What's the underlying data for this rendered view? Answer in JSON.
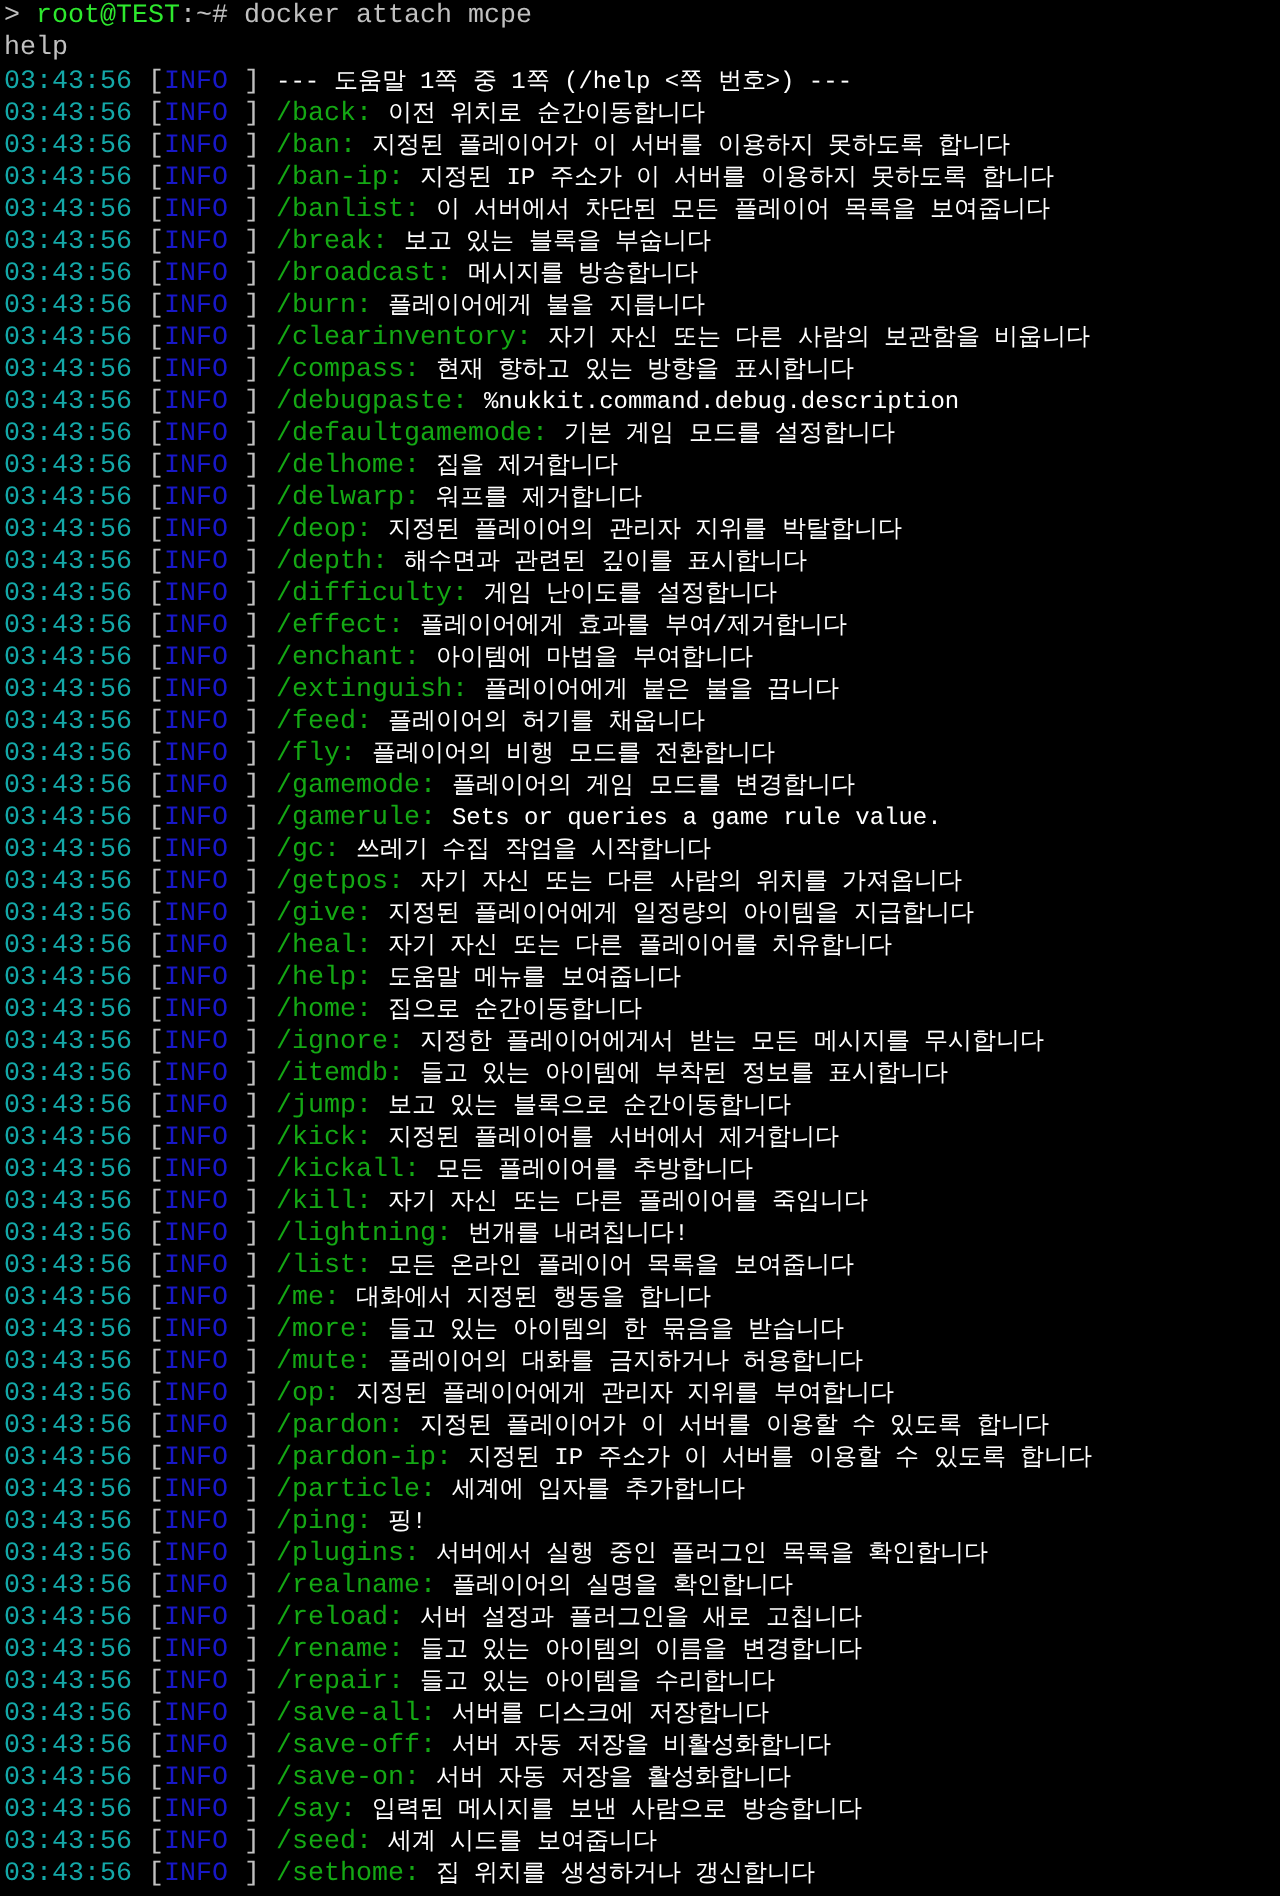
{
  "prompt": {
    "marker": ">",
    "user_host": "root@TEST",
    "path": ":~#",
    "command": "docker attach mcpe"
  },
  "input": "help",
  "log": [
    {
      "time": "03:43:56",
      "level": "[INFO ]",
      "text": "--- 도움말 1쪽 중 1쪽 (/help <쪽 번호>) ---"
    },
    {
      "time": "03:43:56",
      "level": "[INFO ]",
      "command": "/back:",
      "text": "이전 위치로 순간이동합니다"
    },
    {
      "time": "03:43:56",
      "level": "[INFO ]",
      "command": "/ban:",
      "text": "지정된 플레이어가 이 서버를 이용하지 못하도록 합니다"
    },
    {
      "time": "03:43:56",
      "level": "[INFO ]",
      "command": "/ban-ip:",
      "text": "지정된 IP 주소가 이 서버를 이용하지 못하도록 합니다"
    },
    {
      "time": "03:43:56",
      "level": "[INFO ]",
      "command": "/banlist:",
      "text": "이 서버에서 차단된 모든 플레이어 목록을 보여줍니다"
    },
    {
      "time": "03:43:56",
      "level": "[INFO ]",
      "command": "/break:",
      "text": "보고 있는 블록을 부숩니다"
    },
    {
      "time": "03:43:56",
      "level": "[INFO ]",
      "command": "/broadcast:",
      "text": "메시지를 방송합니다"
    },
    {
      "time": "03:43:56",
      "level": "[INFO ]",
      "command": "/burn:",
      "text": "플레이어에게 불을 지릅니다"
    },
    {
      "time": "03:43:56",
      "level": "[INFO ]",
      "command": "/clearinventory:",
      "text": "자기 자신 또는 다른 사람의 보관함을 비웁니다"
    },
    {
      "time": "03:43:56",
      "level": "[INFO ]",
      "command": "/compass:",
      "text": "현재 향하고 있는 방향을 표시합니다"
    },
    {
      "time": "03:43:56",
      "level": "[INFO ]",
      "command": "/debugpaste:",
      "text": "%nukkit.command.debug.description"
    },
    {
      "time": "03:43:56",
      "level": "[INFO ]",
      "command": "/defaultgamemode:",
      "text": "기본 게임 모드를 설정합니다"
    },
    {
      "time": "03:43:56",
      "level": "[INFO ]",
      "command": "/delhome:",
      "text": "집을 제거합니다"
    },
    {
      "time": "03:43:56",
      "level": "[INFO ]",
      "command": "/delwarp:",
      "text": "워프를 제거합니다"
    },
    {
      "time": "03:43:56",
      "level": "[INFO ]",
      "command": "/deop:",
      "text": "지정된 플레이어의 관리자 지위를 박탈합니다"
    },
    {
      "time": "03:43:56",
      "level": "[INFO ]",
      "command": "/depth:",
      "text": "해수면과 관련된 깊이를 표시합니다"
    },
    {
      "time": "03:43:56",
      "level": "[INFO ]",
      "command": "/difficulty:",
      "text": "게임 난이도를 설정합니다"
    },
    {
      "time": "03:43:56",
      "level": "[INFO ]",
      "command": "/effect:",
      "text": "플레이어에게 효과를 부여/제거합니다"
    },
    {
      "time": "03:43:56",
      "level": "[INFO ]",
      "command": "/enchant:",
      "text": "아이템에 마법을 부여합니다"
    },
    {
      "time": "03:43:56",
      "level": "[INFO ]",
      "command": "/extinguish:",
      "text": "플레이어에게 붙은 불을 끕니다"
    },
    {
      "time": "03:43:56",
      "level": "[INFO ]",
      "command": "/feed:",
      "text": "플레이어의 허기를 채웁니다"
    },
    {
      "time": "03:43:56",
      "level": "[INFO ]",
      "command": "/fly:",
      "text": "플레이어의 비행 모드를 전환합니다"
    },
    {
      "time": "03:43:56",
      "level": "[INFO ]",
      "command": "/gamemode:",
      "text": "플레이어의 게임 모드를 변경합니다"
    },
    {
      "time": "03:43:56",
      "level": "[INFO ]",
      "command": "/gamerule:",
      "text": "Sets or queries a game rule value."
    },
    {
      "time": "03:43:56",
      "level": "[INFO ]",
      "command": "/gc:",
      "text": "쓰레기 수집 작업을 시작합니다"
    },
    {
      "time": "03:43:56",
      "level": "[INFO ]",
      "command": "/getpos:",
      "text": "자기 자신 또는 다른 사람의 위치를 가져옵니다"
    },
    {
      "time": "03:43:56",
      "level": "[INFO ]",
      "command": "/give:",
      "text": "지정된 플레이어에게 일정량의 아이템을 지급합니다"
    },
    {
      "time": "03:43:56",
      "level": "[INFO ]",
      "command": "/heal:",
      "text": "자기 자신 또는 다른 플레이어를 치유합니다"
    },
    {
      "time": "03:43:56",
      "level": "[INFO ]",
      "command": "/help:",
      "text": "도움말 메뉴를 보여줍니다"
    },
    {
      "time": "03:43:56",
      "level": "[INFO ]",
      "command": "/home:",
      "text": "집으로 순간이동합니다"
    },
    {
      "time": "03:43:56",
      "level": "[INFO ]",
      "command": "/ignore:",
      "text": "지정한 플레이어에게서 받는 모든 메시지를 무시합니다"
    },
    {
      "time": "03:43:56",
      "level": "[INFO ]",
      "command": "/itemdb:",
      "text": "들고 있는 아이템에 부착된 정보를 표시합니다"
    },
    {
      "time": "03:43:56",
      "level": "[INFO ]",
      "command": "/jump:",
      "text": "보고 있는 블록으로 순간이동합니다"
    },
    {
      "time": "03:43:56",
      "level": "[INFO ]",
      "command": "/kick:",
      "text": "지정된 플레이어를 서버에서 제거합니다"
    },
    {
      "time": "03:43:56",
      "level": "[INFO ]",
      "command": "/kickall:",
      "text": "모든 플레이어를 추방합니다"
    },
    {
      "time": "03:43:56",
      "level": "[INFO ]",
      "command": "/kill:",
      "text": "자기 자신 또는 다른 플레이어를 죽입니다"
    },
    {
      "time": "03:43:56",
      "level": "[INFO ]",
      "command": "/lightning:",
      "text": "번개를 내려칩니다!"
    },
    {
      "time": "03:43:56",
      "level": "[INFO ]",
      "command": "/list:",
      "text": "모든 온라인 플레이어 목록을 보여줍니다"
    },
    {
      "time": "03:43:56",
      "level": "[INFO ]",
      "command": "/me:",
      "text": "대화에서 지정된 행동을 합니다"
    },
    {
      "time": "03:43:56",
      "level": "[INFO ]",
      "command": "/more:",
      "text": "들고 있는 아이템의 한 묶음을 받습니다"
    },
    {
      "time": "03:43:56",
      "level": "[INFO ]",
      "command": "/mute:",
      "text": "플레이어의 대화를 금지하거나 허용합니다"
    },
    {
      "time": "03:43:56",
      "level": "[INFO ]",
      "command": "/op:",
      "text": "지정된 플레이어에게 관리자 지위를 부여합니다"
    },
    {
      "time": "03:43:56",
      "level": "[INFO ]",
      "command": "/pardon:",
      "text": "지정된 플레이어가 이 서버를 이용할 수 있도록 합니다"
    },
    {
      "time": "03:43:56",
      "level": "[INFO ]",
      "command": "/pardon-ip:",
      "text": "지정된 IP 주소가 이 서버를 이용할 수 있도록 합니다"
    },
    {
      "time": "03:43:56",
      "level": "[INFO ]",
      "command": "/particle:",
      "text": "세계에 입자를 추가합니다"
    },
    {
      "time": "03:43:56",
      "level": "[INFO ]",
      "command": "/ping:",
      "text": "핑!"
    },
    {
      "time": "03:43:56",
      "level": "[INFO ]",
      "command": "/plugins:",
      "text": "서버에서 실행 중인 플러그인 목록을 확인합니다"
    },
    {
      "time": "03:43:56",
      "level": "[INFO ]",
      "command": "/realname:",
      "text": "플레이어의 실명을 확인합니다"
    },
    {
      "time": "03:43:56",
      "level": "[INFO ]",
      "command": "/reload:",
      "text": "서버 설정과 플러그인을 새로 고칩니다"
    },
    {
      "time": "03:43:56",
      "level": "[INFO ]",
      "command": "/rename:",
      "text": "들고 있는 아이템의 이름을 변경합니다"
    },
    {
      "time": "03:43:56",
      "level": "[INFO ]",
      "command": "/repair:",
      "text": "들고 있는 아이템을 수리합니다"
    },
    {
      "time": "03:43:56",
      "level": "[INFO ]",
      "command": "/save-all:",
      "text": "서버를 디스크에 저장합니다"
    },
    {
      "time": "03:43:56",
      "level": "[INFO ]",
      "command": "/save-off:",
      "text": "서버 자동 저장을 비활성화합니다"
    },
    {
      "time": "03:43:56",
      "level": "[INFO ]",
      "command": "/save-on:",
      "text": "서버 자동 저장을 활성화합니다"
    },
    {
      "time": "03:43:56",
      "level": "[INFO ]",
      "command": "/say:",
      "text": "입력된 메시지를 보낸 사람으로 방송합니다"
    },
    {
      "time": "03:43:56",
      "level": "[INFO ]",
      "command": "/seed:",
      "text": "세계 시드를 보여줍니다"
    },
    {
      "time": "03:43:56",
      "level": "[INFO ]",
      "command": "/sethome:",
      "text": "집 위치를 생성하거나 갱신합니다"
    }
  ]
}
